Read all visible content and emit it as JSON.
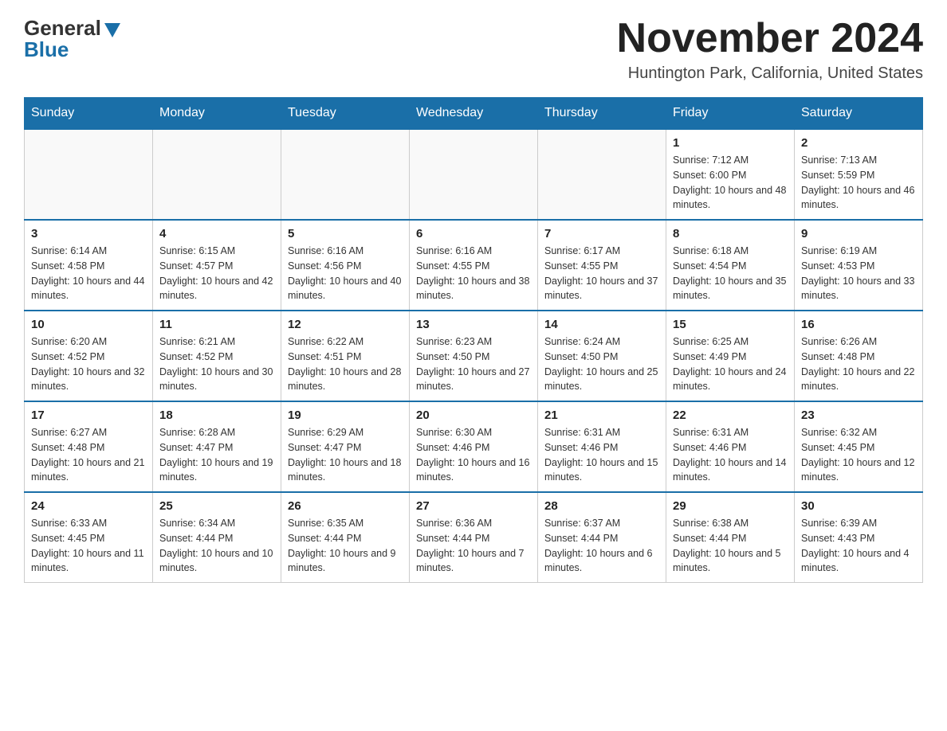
{
  "header": {
    "logo_general": "General",
    "logo_blue": "Blue",
    "month_title": "November 2024",
    "location": "Huntington Park, California, United States"
  },
  "days_of_week": [
    "Sunday",
    "Monday",
    "Tuesday",
    "Wednesday",
    "Thursday",
    "Friday",
    "Saturday"
  ],
  "weeks": [
    [
      {
        "day": "",
        "info": ""
      },
      {
        "day": "",
        "info": ""
      },
      {
        "day": "",
        "info": ""
      },
      {
        "day": "",
        "info": ""
      },
      {
        "day": "",
        "info": ""
      },
      {
        "day": "1",
        "info": "Sunrise: 7:12 AM\nSunset: 6:00 PM\nDaylight: 10 hours and 48 minutes."
      },
      {
        "day": "2",
        "info": "Sunrise: 7:13 AM\nSunset: 5:59 PM\nDaylight: 10 hours and 46 minutes."
      }
    ],
    [
      {
        "day": "3",
        "info": "Sunrise: 6:14 AM\nSunset: 4:58 PM\nDaylight: 10 hours and 44 minutes."
      },
      {
        "day": "4",
        "info": "Sunrise: 6:15 AM\nSunset: 4:57 PM\nDaylight: 10 hours and 42 minutes."
      },
      {
        "day": "5",
        "info": "Sunrise: 6:16 AM\nSunset: 4:56 PM\nDaylight: 10 hours and 40 minutes."
      },
      {
        "day": "6",
        "info": "Sunrise: 6:16 AM\nSunset: 4:55 PM\nDaylight: 10 hours and 38 minutes."
      },
      {
        "day": "7",
        "info": "Sunrise: 6:17 AM\nSunset: 4:55 PM\nDaylight: 10 hours and 37 minutes."
      },
      {
        "day": "8",
        "info": "Sunrise: 6:18 AM\nSunset: 4:54 PM\nDaylight: 10 hours and 35 minutes."
      },
      {
        "day": "9",
        "info": "Sunrise: 6:19 AM\nSunset: 4:53 PM\nDaylight: 10 hours and 33 minutes."
      }
    ],
    [
      {
        "day": "10",
        "info": "Sunrise: 6:20 AM\nSunset: 4:52 PM\nDaylight: 10 hours and 32 minutes."
      },
      {
        "day": "11",
        "info": "Sunrise: 6:21 AM\nSunset: 4:52 PM\nDaylight: 10 hours and 30 minutes."
      },
      {
        "day": "12",
        "info": "Sunrise: 6:22 AM\nSunset: 4:51 PM\nDaylight: 10 hours and 28 minutes."
      },
      {
        "day": "13",
        "info": "Sunrise: 6:23 AM\nSunset: 4:50 PM\nDaylight: 10 hours and 27 minutes."
      },
      {
        "day": "14",
        "info": "Sunrise: 6:24 AM\nSunset: 4:50 PM\nDaylight: 10 hours and 25 minutes."
      },
      {
        "day": "15",
        "info": "Sunrise: 6:25 AM\nSunset: 4:49 PM\nDaylight: 10 hours and 24 minutes."
      },
      {
        "day": "16",
        "info": "Sunrise: 6:26 AM\nSunset: 4:48 PM\nDaylight: 10 hours and 22 minutes."
      }
    ],
    [
      {
        "day": "17",
        "info": "Sunrise: 6:27 AM\nSunset: 4:48 PM\nDaylight: 10 hours and 21 minutes."
      },
      {
        "day": "18",
        "info": "Sunrise: 6:28 AM\nSunset: 4:47 PM\nDaylight: 10 hours and 19 minutes."
      },
      {
        "day": "19",
        "info": "Sunrise: 6:29 AM\nSunset: 4:47 PM\nDaylight: 10 hours and 18 minutes."
      },
      {
        "day": "20",
        "info": "Sunrise: 6:30 AM\nSunset: 4:46 PM\nDaylight: 10 hours and 16 minutes."
      },
      {
        "day": "21",
        "info": "Sunrise: 6:31 AM\nSunset: 4:46 PM\nDaylight: 10 hours and 15 minutes."
      },
      {
        "day": "22",
        "info": "Sunrise: 6:31 AM\nSunset: 4:46 PM\nDaylight: 10 hours and 14 minutes."
      },
      {
        "day": "23",
        "info": "Sunrise: 6:32 AM\nSunset: 4:45 PM\nDaylight: 10 hours and 12 minutes."
      }
    ],
    [
      {
        "day": "24",
        "info": "Sunrise: 6:33 AM\nSunset: 4:45 PM\nDaylight: 10 hours and 11 minutes."
      },
      {
        "day": "25",
        "info": "Sunrise: 6:34 AM\nSunset: 4:44 PM\nDaylight: 10 hours and 10 minutes."
      },
      {
        "day": "26",
        "info": "Sunrise: 6:35 AM\nSunset: 4:44 PM\nDaylight: 10 hours and 9 minutes."
      },
      {
        "day": "27",
        "info": "Sunrise: 6:36 AM\nSunset: 4:44 PM\nDaylight: 10 hours and 7 minutes."
      },
      {
        "day": "28",
        "info": "Sunrise: 6:37 AM\nSunset: 4:44 PM\nDaylight: 10 hours and 6 minutes."
      },
      {
        "day": "29",
        "info": "Sunrise: 6:38 AM\nSunset: 4:44 PM\nDaylight: 10 hours and 5 minutes."
      },
      {
        "day": "30",
        "info": "Sunrise: 6:39 AM\nSunset: 4:43 PM\nDaylight: 10 hours and 4 minutes."
      }
    ]
  ]
}
